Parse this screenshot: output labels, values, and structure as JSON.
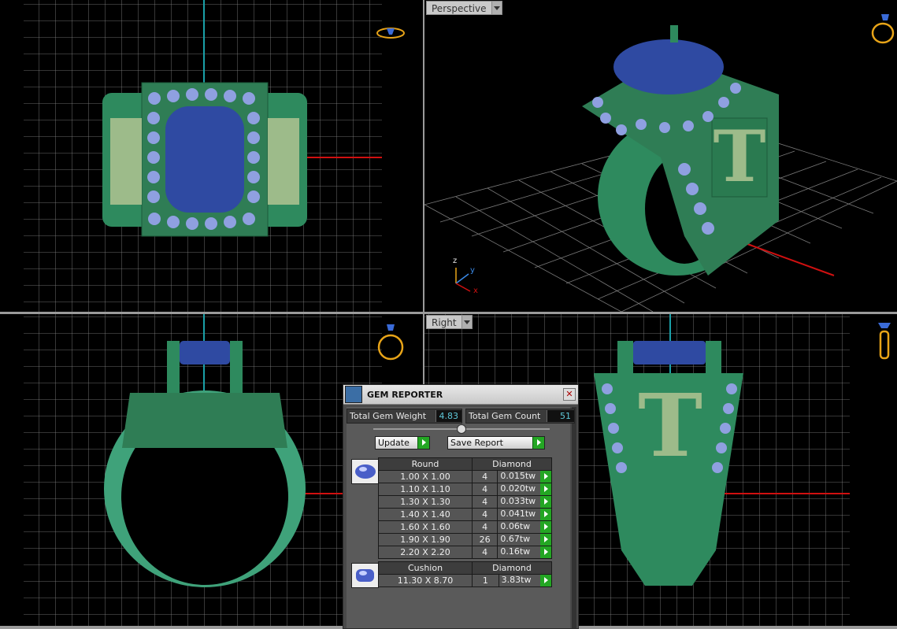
{
  "viewports": {
    "perspective_label": "Perspective",
    "right_label": "Right"
  },
  "axis_gizmo": {
    "x": "x",
    "y": "y",
    "z": "z"
  },
  "gem_reporter": {
    "title": "GEM REPORTER",
    "close_label": "✕",
    "total_weight_label": "Total Gem Weight",
    "total_weight": "4.83",
    "total_count_label": "Total Gem Count",
    "total_count": "51",
    "update_label": "Update",
    "save_report_label": "Save Report",
    "groups": [
      {
        "shape": "Round",
        "material": "Diamond",
        "rows": [
          {
            "size": "1.00 X 1.00",
            "count": "4",
            "weight": "0.015tw"
          },
          {
            "size": "1.10 X 1.10",
            "count": "4",
            "weight": "0.020tw"
          },
          {
            "size": "1.30 X 1.30",
            "count": "4",
            "weight": "0.033tw"
          },
          {
            "size": "1.40 X 1.40",
            "count": "4",
            "weight": "0.041tw"
          },
          {
            "size": "1.60 X 1.60",
            "count": "4",
            "weight": "0.06tw"
          },
          {
            "size": "1.90 X 1.90",
            "count": "26",
            "weight": "0.67tw"
          },
          {
            "size": "2.20 X 2.20",
            "count": "4",
            "weight": "0.16tw"
          }
        ]
      },
      {
        "shape": "Cushion",
        "material": "Diamond",
        "rows": [
          {
            "size": "11.30 X 8.70",
            "count": "1",
            "weight": "3.83tw"
          }
        ]
      }
    ]
  },
  "colors": {
    "metal": "#2e8a5e",
    "gem": "#3a4fa8",
    "accent_gold": "#e8a418",
    "axis_x": "#d01010",
    "axis_y": "#1aa0a8"
  }
}
